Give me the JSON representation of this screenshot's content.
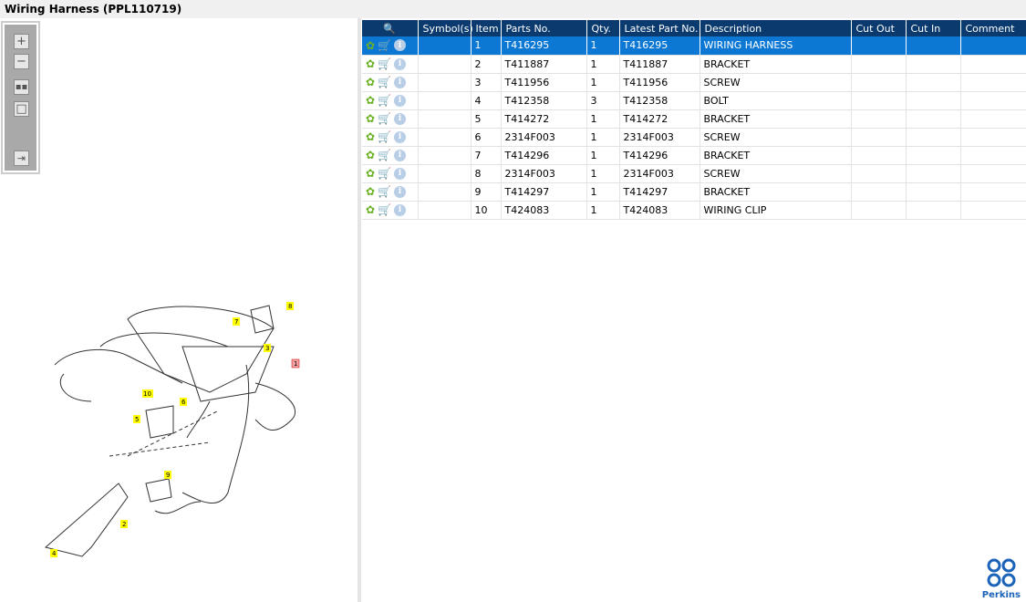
{
  "title": "Wiring Harness (PPL110719)",
  "toolbar": {
    "zoom_in": "zoom-in",
    "zoom_out": "zoom-out",
    "fit": "fit-all",
    "actual": "actual-size",
    "export": "export"
  },
  "callouts": [
    "1",
    "2",
    "3",
    "4",
    "5",
    "6",
    "7",
    "8",
    "9",
    "10"
  ],
  "table": {
    "headers": [
      "Symbol(s)",
      "Item",
      "Parts No.",
      "Qty.",
      "Latest Part No.",
      "Description",
      "Cut Out",
      "Cut In",
      "Comment"
    ],
    "rows": [
      {
        "item": "1",
        "part": "T416295",
        "qty": "1",
        "latest": "T416295",
        "desc": "WIRING HARNESS"
      },
      {
        "item": "2",
        "part": "T411887",
        "qty": "1",
        "latest": "T411887",
        "desc": "BRACKET"
      },
      {
        "item": "3",
        "part": "T411956",
        "qty": "1",
        "latest": "T411956",
        "desc": "SCREW"
      },
      {
        "item": "4",
        "part": "T412358",
        "qty": "3",
        "latest": "T412358",
        "desc": "BOLT"
      },
      {
        "item": "5",
        "part": "T414272",
        "qty": "1",
        "latest": "T414272",
        "desc": "BRACKET"
      },
      {
        "item": "6",
        "part": "2314F003",
        "qty": "1",
        "latest": "2314F003",
        "desc": "SCREW"
      },
      {
        "item": "7",
        "part": "T414296",
        "qty": "1",
        "latest": "T414296",
        "desc": "BRACKET"
      },
      {
        "item": "8",
        "part": "2314F003",
        "qty": "1",
        "latest": "2314F003",
        "desc": "SCREW"
      },
      {
        "item": "9",
        "part": "T414297",
        "qty": "1",
        "latest": "T414297",
        "desc": "BRACKET"
      },
      {
        "item": "10",
        "part": "T424083",
        "qty": "1",
        "latest": "T424083",
        "desc": "WIRING CLIP"
      }
    ]
  },
  "logo": {
    "text": "Perkins"
  }
}
